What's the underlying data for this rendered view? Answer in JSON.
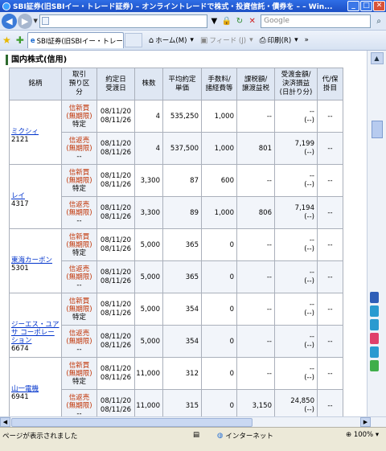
{
  "window": {
    "title": "SBI証券(旧SBIイー・トレード証券) – オンライントレードで株式・投資信託・債券を – – Win..."
  },
  "addressbar": {
    "url_text": "",
    "search_placeholder": "Google"
  },
  "tabs": [
    {
      "label": "SBI証券(旧SBIイー・トレー..."
    }
  ],
  "commands": {
    "home": "ホーム(M)",
    "feeds": "フィード (J)",
    "print": "印刷(R)"
  },
  "page": {
    "heading": "国内株式(信用)",
    "columns": [
      {
        "key": "name",
        "label": "銘柄"
      },
      {
        "key": "kbn",
        "label": "取引\n預り区\n分"
      },
      {
        "key": "date",
        "label": "約定日\n受渡日"
      },
      {
        "key": "qty",
        "label": "株数"
      },
      {
        "key": "price",
        "label": "平均約定\n単価"
      },
      {
        "key": "fee",
        "label": "手数料/\n諸経費等"
      },
      {
        "key": "tax",
        "label": "課税額/\n譲渡益税"
      },
      {
        "key": "amount",
        "label": "受渡金額/\n決済損益\n(日計り分)"
      },
      {
        "key": "daily",
        "label": "代/保\n掛目"
      }
    ],
    "stocks": [
      {
        "name": "ミクシィ",
        "code": "2121",
        "rows": [
          {
            "k1": "信新買",
            "k2": "(無期限)",
            "k3": "特定",
            "d1": "08/11/20",
            "d2": "08/11/26",
            "qty": "4",
            "price": "535,250",
            "fee": "1,000",
            "tax": "--",
            "amt1": "--",
            "amt2": "(--)",
            "daily": "--"
          },
          {
            "k1": "信返売",
            "k2": "(無期限)",
            "k3": "--",
            "d1": "08/11/20",
            "d2": "08/11/26",
            "qty": "4",
            "price": "537,500",
            "fee": "1,000",
            "tax": "801",
            "amt1": "7,199",
            "amt2": "(--)",
            "daily": "--"
          }
        ]
      },
      {
        "name": "レイ",
        "code": "4317",
        "rows": [
          {
            "k1": "信新買",
            "k2": "(無期限)",
            "k3": "特定",
            "d1": "08/11/20",
            "d2": "08/11/26",
            "qty": "3,300",
            "price": "87",
            "fee": "600",
            "tax": "--",
            "amt1": "--",
            "amt2": "(--)",
            "daily": "--"
          },
          {
            "k1": "信返売",
            "k2": "(無期限)",
            "k3": "--",
            "d1": "08/11/20",
            "d2": "08/11/26",
            "qty": "3,300",
            "price": "89",
            "fee": "1,000",
            "tax": "806",
            "amt1": "7,194",
            "amt2": "(--)",
            "daily": "--"
          }
        ]
      },
      {
        "name": "東海カーボン",
        "code": "5301",
        "rows": [
          {
            "k1": "信新買",
            "k2": "(無期限)",
            "k3": "特定",
            "d1": "08/11/20",
            "d2": "08/11/26",
            "qty": "5,000",
            "price": "365",
            "fee": "0",
            "tax": "--",
            "amt1": "--",
            "amt2": "(--)",
            "daily": "--"
          },
          {
            "k1": "信返売",
            "k2": "(無期限)",
            "k3": "--",
            "d1": "08/11/20",
            "d2": "08/11/26",
            "qty": "5,000",
            "price": "365",
            "fee": "0",
            "tax": "--",
            "amt1": "--",
            "amt2": "(--)",
            "daily": "--"
          }
        ]
      },
      {
        "name": "ジーエス・ユアサ コーポレーション",
        "code": "6674",
        "rows": [
          {
            "k1": "信新買",
            "k2": "(無期限)",
            "k3": "特定",
            "d1": "08/11/20",
            "d2": "08/11/26",
            "qty": "5,000",
            "price": "354",
            "fee": "0",
            "tax": "--",
            "amt1": "--",
            "amt2": "(--)",
            "daily": "--"
          },
          {
            "k1": "信返売",
            "k2": "(無期限)",
            "k3": "--",
            "d1": "08/11/20",
            "d2": "08/11/26",
            "qty": "5,000",
            "price": "354",
            "fee": "0",
            "tax": "--",
            "amt1": "--",
            "amt2": "(--)",
            "daily": "--"
          }
        ]
      },
      {
        "name": "山一電機",
        "code": "6941",
        "rows": [
          {
            "k1": "信新買",
            "k2": "(無期限)",
            "k3": "特定",
            "d1": "08/11/20",
            "d2": "08/11/26",
            "qty": "11,000",
            "price": "312",
            "fee": "0",
            "tax": "--",
            "amt1": "--",
            "amt2": "(--)",
            "daily": "--"
          },
          {
            "k1": "信返売",
            "k2": "(無期限)",
            "k3": "--",
            "d1": "08/11/20",
            "d2": "08/11/26",
            "qty": "11,000",
            "price": "315",
            "fee": "0",
            "tax": "3,150",
            "amt1": "24,850",
            "amt2": "(--)",
            "daily": "--"
          }
        ]
      }
    ]
  },
  "statusbar": {
    "text": "ページが表示されました",
    "zone": "インターネット",
    "zoom": "100%"
  }
}
